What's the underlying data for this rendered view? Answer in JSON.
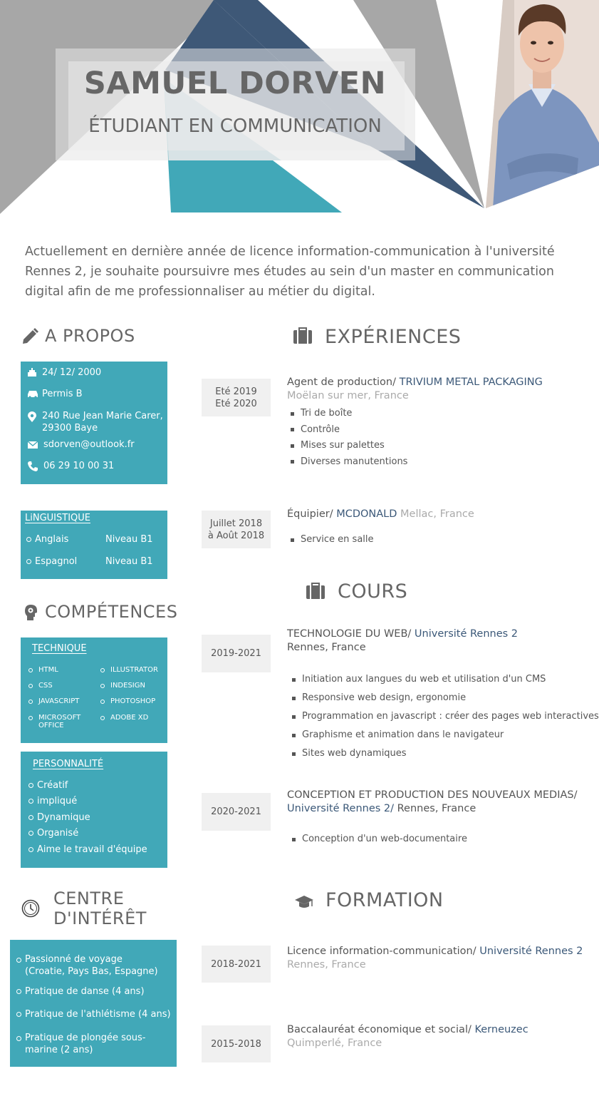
{
  "header": {
    "name": "SAMUEL DORVEN",
    "job_title": "ÉTUDIANT EN COMMUNICATION",
    "colors": {
      "gray": "#a7a7a7",
      "navy": "#3e5877",
      "teal": "#41a8b8",
      "light_teal": "#c7e1e7"
    }
  },
  "intro": "Actuellement en dernière année de licence information-communication à l'université Rennes 2, je souhaite poursuivre mes études au sein d'un master en communication digital  afin de me professionnaliser au métier du digital.",
  "about": {
    "title": "A PROPOS",
    "icon": "pencil-icon",
    "items": [
      {
        "icon": "cake-icon",
        "text": "24/ 12/ 2000"
      },
      {
        "icon": "car-icon",
        "text": "Permis B"
      },
      {
        "icon": "location-pin-icon",
        "text": "240 Rue Jean Marie Carer, 29300 Baye"
      },
      {
        "icon": "envelope-icon",
        "text": "sdorven@outlook.fr"
      },
      {
        "icon": "phone-icon",
        "text": "06 29 10 00 31"
      }
    ]
  },
  "languages": {
    "title": "LiNGUISTIQUE",
    "items": [
      {
        "language": "Anglais",
        "level": "Niveau B1"
      },
      {
        "language": "Espagnol",
        "level": "Niveau B1"
      }
    ]
  },
  "skills": {
    "title": "COMPÉTENCES",
    "icon": "head-gears-icon",
    "technical": {
      "title": "TECHNIQUE",
      "left": [
        "HTML",
        "CSS",
        "JAVASCRIPT",
        "MICROSOFT OFFICE"
      ],
      "right": [
        "ILLUSTRATOR",
        "INDESIGN",
        "PHOTOSHOP",
        "ADOBE XD"
      ]
    },
    "personality": {
      "title": "PERSONNALITÉ",
      "items": [
        "Créatif",
        "impliqué",
        "Dynamique",
        "Organisé",
        "Aime le travail d'équipe"
      ]
    }
  },
  "interests": {
    "title_line1": "CENTRE",
    "title_line2": "D'INTÉRÊT",
    "icon": "clock-icon",
    "items": [
      "Passionné de voyage (Croatie, Pays Bas, Espagne)",
      "Pratique de danse (4 ans)",
      "Pratique de l'athlétisme (4 ans)",
      "Pratique de plongée sous-marine (2 ans)"
    ]
  },
  "experiences": {
    "title": "EXPÉRIENCES",
    "icon": "briefcase-icon",
    "items": [
      {
        "date_line1": "Eté 2019",
        "date_line2": "Eté 2020",
        "role": "Agent de production/ ",
        "company": "TRIVIUM METAL PACKAGING",
        "location": "Moëlan sur mer, France",
        "tasks": [
          "Tri de boîte",
          "Contrôle",
          "Mises sur palettes",
          "Diverses manutentions"
        ]
      },
      {
        "date_line1": "Juillet 2018",
        "date_line2": "à Août 2018",
        "role": "Équipier/ ",
        "company": "MCDONALD",
        "location": " Mellac, France",
        "tasks": [
          "Service en salle"
        ]
      }
    ]
  },
  "courses": {
    "title": "COURS",
    "icon": "briefcase-icon",
    "items": [
      {
        "date": "2019-2021",
        "name": "TECHNOLOGIE DU WEB/ ",
        "school": "Université Rennes 2",
        "location": "Rennes, France",
        "topics": [
          "Initiation aux langues du web et utilisation d'un CMS",
          "Responsive web design, ergonomie",
          "Programmation en javascript : créer des pages web interactives",
          "Graphisme et animation dans le navigateur",
          "Sites web dynamiques"
        ]
      },
      {
        "date": "2020-2021",
        "name": "CONCEPTION ET PRODUCTION DES NOUVEAUX MEDIAS/",
        "school": "Université Rennes 2/",
        "location": " Rennes, France",
        "topics": [
          "Conception d'un web-documentaire"
        ]
      }
    ]
  },
  "education": {
    "title": "FORMATION",
    "icon": "graduation-cap-icon",
    "items": [
      {
        "date": "2018-2021",
        "degree": "Licence information-communication/ ",
        "school": "Université Rennes 2",
        "location": "Rennes, France"
      },
      {
        "date": "2015-2018",
        "degree": "Baccalauréat économique et social/ ",
        "school": "Kerneuzec",
        "location": "Quimperlé, France"
      }
    ]
  }
}
